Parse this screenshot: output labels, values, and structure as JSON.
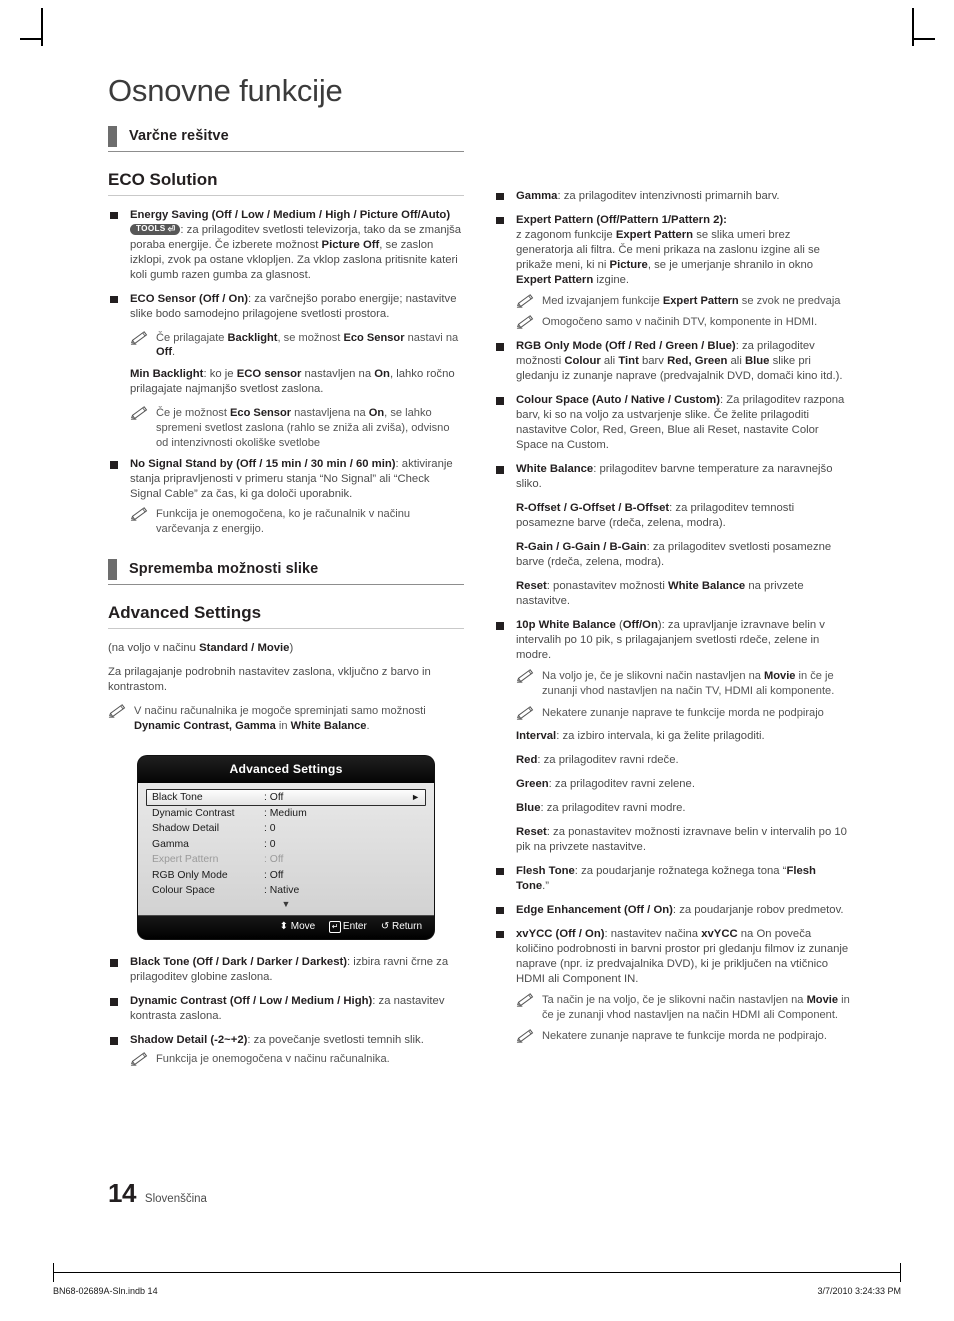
{
  "document": {
    "title": "Osnovne funkcije",
    "page_number": "14",
    "language": "Slovenščina",
    "footer_file": "BN68-02689A-Sln.indb   14",
    "footer_timestamp": "3/7/2010   3:24:33 PM"
  },
  "left_column": {
    "section1_header": "Varčne rešitve",
    "subhead1": "ECO Solution",
    "items": [
      {
        "bold": "Energy Saving (Off / Low / Medium / High / Picture Off/Auto)",
        "chip": "TOOLS",
        "text": ": za prilagoditev svetlosti televizorja, tako da se zmanjša poraba energije. Če izberete možnost ",
        "bold2": "Picture Off",
        "text2": ", se zaslon izklopi, zvok pa ostane vklopljen. Za vklop zaslona pritisnite kateri koli gumb razen gumba za glasnost."
      },
      {
        "bold": "ECO Sensor (Off / On)",
        "text": ": za varčnejšo porabo energije; nastavitve slike bodo samodejno prilagojene svetlosti prostora."
      }
    ],
    "note1_a": "Če prilagajate ",
    "note1_b": "Backlight",
    "note1_c": ", se možnost ",
    "note1_d": "Eco Sensor",
    "note1_e": " nastavi na ",
    "note1_f": "Off",
    "note1_g": ".",
    "minbl_bold": "Min Backlight",
    "minbl_t1": ": ko je ",
    "minbl_b2": "ECO sensor",
    "minbl_t2": " nastavljen na ",
    "minbl_b3": "On",
    "minbl_t3": ", lahko ročno prilagajate najmanjšo svetlost zaslona.",
    "note2_a": "Če je možnost ",
    "note2_b": "Eco Sensor",
    "note2_c": " nastavljena na ",
    "note2_d": "On",
    "note2_e": ", se lahko spremeni svetlost zaslona (rahlo se zniža ali zviša), odvisno od intenzivnosti okoliške svetlobe",
    "nosignal_bold": "No Signal Stand by (Off / 15 min / 30 min / 60 min)",
    "nosignal_text": ": aktiviranje stanja pripravljenosti v primeru stanja “No Signal” ali “Check Signal Cable” za čas, ki ga določi uporabnik.",
    "note3": "Funkcija je onemogočena, ko je računalnik v načinu varčevanja z energijo.",
    "section2_header": "Sprememba možnosti slike",
    "subhead2": "Advanced Settings",
    "avail_t1": "(na voljo v načinu ",
    "avail_b": "Standard / Movie",
    "avail_t2": ")",
    "desc2": "Za prilagajanje podrobnih nastavitev zaslona, vključno z barvo in kontrastom.",
    "note4_a": "V načinu računalnika je mogoče spreminjati samo možnosti ",
    "note4_b": "Dynamic Contrast, Gamma",
    "note4_c": " in ",
    "note4_d": "White Balance",
    "note4_e": ".",
    "items2": [
      {
        "bold": "Black Tone (Off / Dark / Darker / Darkest)",
        "text": ": izbira ravni črne za prilagoditev globine zaslona."
      },
      {
        "bold": "Dynamic Contrast (Off / Low / Medium / High)",
        "text": ": za nastavitev kontrasta zaslona."
      },
      {
        "bold": "Shadow Detail (-2~+2)",
        "text": ": za povečanje svetlosti temnih slik."
      }
    ],
    "note5": "Funkcija je onemogočena v načinu računalnika."
  },
  "osd": {
    "title": "Advanced Settings",
    "rows": [
      {
        "label": "Black Tone",
        "value": ": Off",
        "selected": true,
        "dim": false,
        "arrow": "►"
      },
      {
        "label": "Dynamic Contrast",
        "value": ": Medium",
        "selected": false,
        "dim": false,
        "arrow": ""
      },
      {
        "label": "Shadow Detail",
        "value": ": 0",
        "selected": false,
        "dim": false,
        "arrow": ""
      },
      {
        "label": "Gamma",
        "value": ": 0",
        "selected": false,
        "dim": false,
        "arrow": ""
      },
      {
        "label": "Expert Pattern",
        "value": ": Off",
        "selected": false,
        "dim": true,
        "arrow": ""
      },
      {
        "label": "RGB Only Mode",
        "value": ": Off",
        "selected": false,
        "dim": false,
        "arrow": ""
      },
      {
        "label": "Colour Space",
        "value": ": Native",
        "selected": false,
        "dim": false,
        "arrow": ""
      }
    ],
    "scroll_down": "▼",
    "footer": {
      "move": "Move",
      "move_icon": "⬍",
      "enter": "Enter",
      "enter_icon": "↵",
      "return": "Return",
      "return_icon": "↺"
    }
  },
  "right_column": {
    "gamma_bold": "Gamma",
    "gamma_text": ": za prilagoditev intenzivnosti primarnih barv.",
    "ep_bold": "Expert Pattern (Off/Pattern 1/Pattern 2)",
    "ep_colon": ":",
    "ep_t1": "z zagonom funkcije ",
    "ep_b1": "Expert Pattern",
    "ep_t2": " se slika umeri brez generatorja ali filtra. Če meni prikaza na zaslonu izgine ali se prikaže meni, ki ni ",
    "ep_b2": "Picture",
    "ep_t3": ", se je umerjanje shranilo in okno ",
    "ep_b3": "Expert Pattern",
    "ep_t4": " izgine.",
    "ep_note1_a": "Med izvajanjem funkcije ",
    "ep_note1_b": "Expert Pattern",
    "ep_note1_c": " se zvok ne predvaja",
    "ep_note2": "Omogočeno samo v načinih DTV, komponente in HDMI.",
    "rgb_bold": "RGB Only Mode (Off / Red / Green / Blue)",
    "rgb_t1": ": za prilagoditev možnosti ",
    "rgb_b1": "Colour",
    "rgb_t2": " ali ",
    "rgb_b2": "Tint",
    "rgb_t3": " barv ",
    "rgb_b3": "Red, Green",
    "rgb_t4": " ali ",
    "rgb_b4": "Blue",
    "rgb_t5": " slike pri gledanju iz zunanje naprave (predvajalnik DVD, domači kino itd.).",
    "cs_bold": "Colour Space (Auto / Native / Custom)",
    "cs_text": ": Za prilagoditev razpona barv, ki so na voljo za ustvarjenje slike. Če želite prilagoditi nastavitve Color, Red, Green, Blue ali Reset, nastavite Color Space na Custom.",
    "wb_bold": "White Balance",
    "wb_text": ": prilagoditev barvne temperature za naravnejšo sliko.",
    "offset_bold": "R-Offset / G-Offset / B-Offset",
    "offset_text": ": za prilagoditev temnosti posamezne barve (rdeča, zelena, modra).",
    "gain_bold": "R-Gain / G-Gain / B-Gain",
    "gain_text": ": za prilagoditev svetlosti posamezne barve (rdeča, zelena, modra).",
    "reset1_bold": "Reset",
    "reset1_t1": ": ponastavitev možnosti ",
    "reset1_b1": "White Balance",
    "reset1_t2": " na privzete nastavitve.",
    "tenp_b1": "10p White Balance",
    "tenp_t1": " (",
    "tenp_b2": "Off/On",
    "tenp_t2": "): za upravljanje izravnave belin v intervalih po 10 pik, s prilagajanjem svetlosti rdeče, zelene in modre.",
    "tenp_note1_a": "Na voljo je, če je slikovni način nastavljen na ",
    "tenp_note1_b": "Movie",
    "tenp_note1_c": " in če je zunanji vhod nastavljen na način TV, HDMI ali komponente.",
    "tenp_note2": "Nekatere zunanje naprave te funkcije morda ne podpirajo",
    "interval_bold": "Interval",
    "interval_text": ": za izbiro intervala, ki ga želite prilagoditi.",
    "red_bold": "Red",
    "red_text": ": za prilagoditev ravni rdeče.",
    "green_bold": "Green",
    "green_text": ": za prilagoditev ravni zelene.",
    "blue_bold": "Blue",
    "blue_text": ": za prilagoditev ravni modre.",
    "reset2_bold": "Reset",
    "reset2_text": ": za ponastavitev možnosti izravnave belin v intervalih po 10 pik na privzete nastavitve.",
    "flesh_bold": "Flesh Tone",
    "flesh_t1": ": za poudarjanje rožnatega kožnega tona “",
    "flesh_b1": "Flesh Tone",
    "flesh_t2": ".”",
    "edge_bold": "Edge Enhancement (Off / On)",
    "edge_text": ": za poudarjanje robov predmetov.",
    "xv_bold": "xvYCC (Off / On)",
    "xv_t1": ": nastavitev načina ",
    "xv_b1": "xvYCC",
    "xv_t2": " na On poveča količino podrobnosti in barvni prostor pri gledanju filmov iz zunanje naprave (npr. iz predvajalnika DVD), ki je priključen na vtičnico HDMI ali Component IN.",
    "xv_note1_a": "Ta način je na voljo, če je slikovni način nastavljen na ",
    "xv_note1_b": "Movie",
    "xv_note1_c": " in če je zunanji vhod nastavljen na način HDMI ali Component.",
    "xv_note2": "Nekatere zunanje naprave te funkcije morda ne podpirajo."
  }
}
